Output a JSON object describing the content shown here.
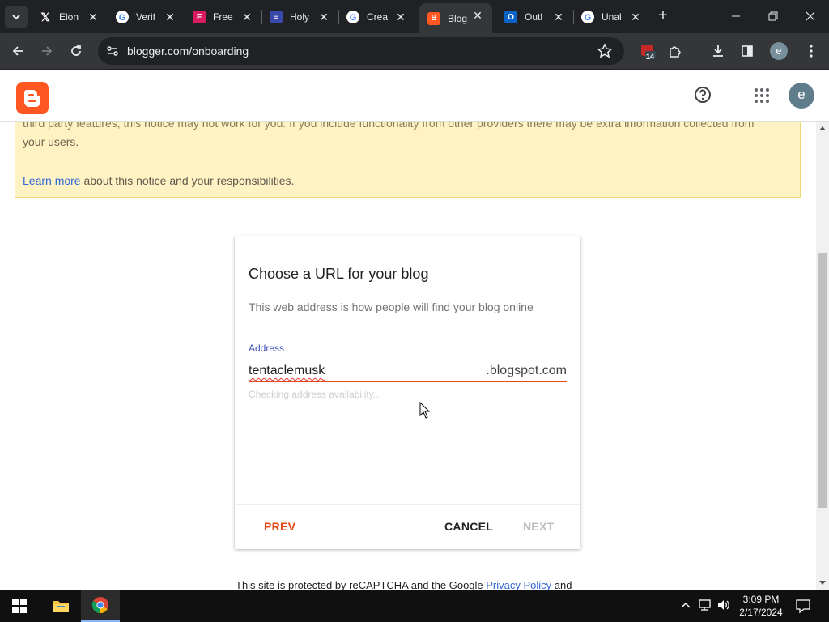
{
  "browser": {
    "tabs": [
      {
        "title": "Elon",
        "favicon": "x-icon",
        "color": "#000000"
      },
      {
        "title": "Verif",
        "favicon": "google-icon",
        "color": "#ffffff"
      },
      {
        "title": "Free",
        "favicon": "fr-icon",
        "color": "#d81b60"
      },
      {
        "title": "Holy",
        "favicon": "e-icon",
        "color": "#3949ab"
      },
      {
        "title": "Crea",
        "favicon": "google-icon",
        "color": "#ffffff"
      },
      {
        "title": "Blog",
        "favicon": "blogger-icon",
        "color": "#ff5722"
      },
      {
        "title": "Outl",
        "favicon": "outlook-icon",
        "color": "#0a64c8"
      },
      {
        "title": "Unal",
        "favicon": "google-icon",
        "color": "#ffffff"
      }
    ],
    "active_tab": 5,
    "url": "blogger.com/onboarding",
    "extension_badge": "14",
    "profile_initial": "e"
  },
  "header": {
    "account_initial": "e"
  },
  "notice": {
    "line1": "third party features, this notice may not work for you. If you include functionality from other providers there may be extra information collected from",
    "line2": "your users.",
    "link": "Learn more",
    "line3_rest": " about this notice and your responsibilities."
  },
  "dialog": {
    "title": "Choose a URL for your blog",
    "subtitle": "This web address is how people will find your blog online",
    "address_label": "Address",
    "address_value": "tentaclemusk",
    "address_suffix": ".blogspot.com",
    "status": "Checking address availability...",
    "prev": "PREV",
    "cancel": "CANCEL",
    "next": "NEXT"
  },
  "footer": {
    "recaptcha_text": "This site is protected by reCAPTCHA and the Google ",
    "privacy_link": "Privacy Policy",
    "recaptcha_tail": " and"
  },
  "taskbar": {
    "time": "3:09 PM",
    "date": "2/17/2024"
  },
  "colors": {
    "accent": "#e64a19",
    "link": "#3367d6",
    "notice_bg": "#fff3c4"
  }
}
